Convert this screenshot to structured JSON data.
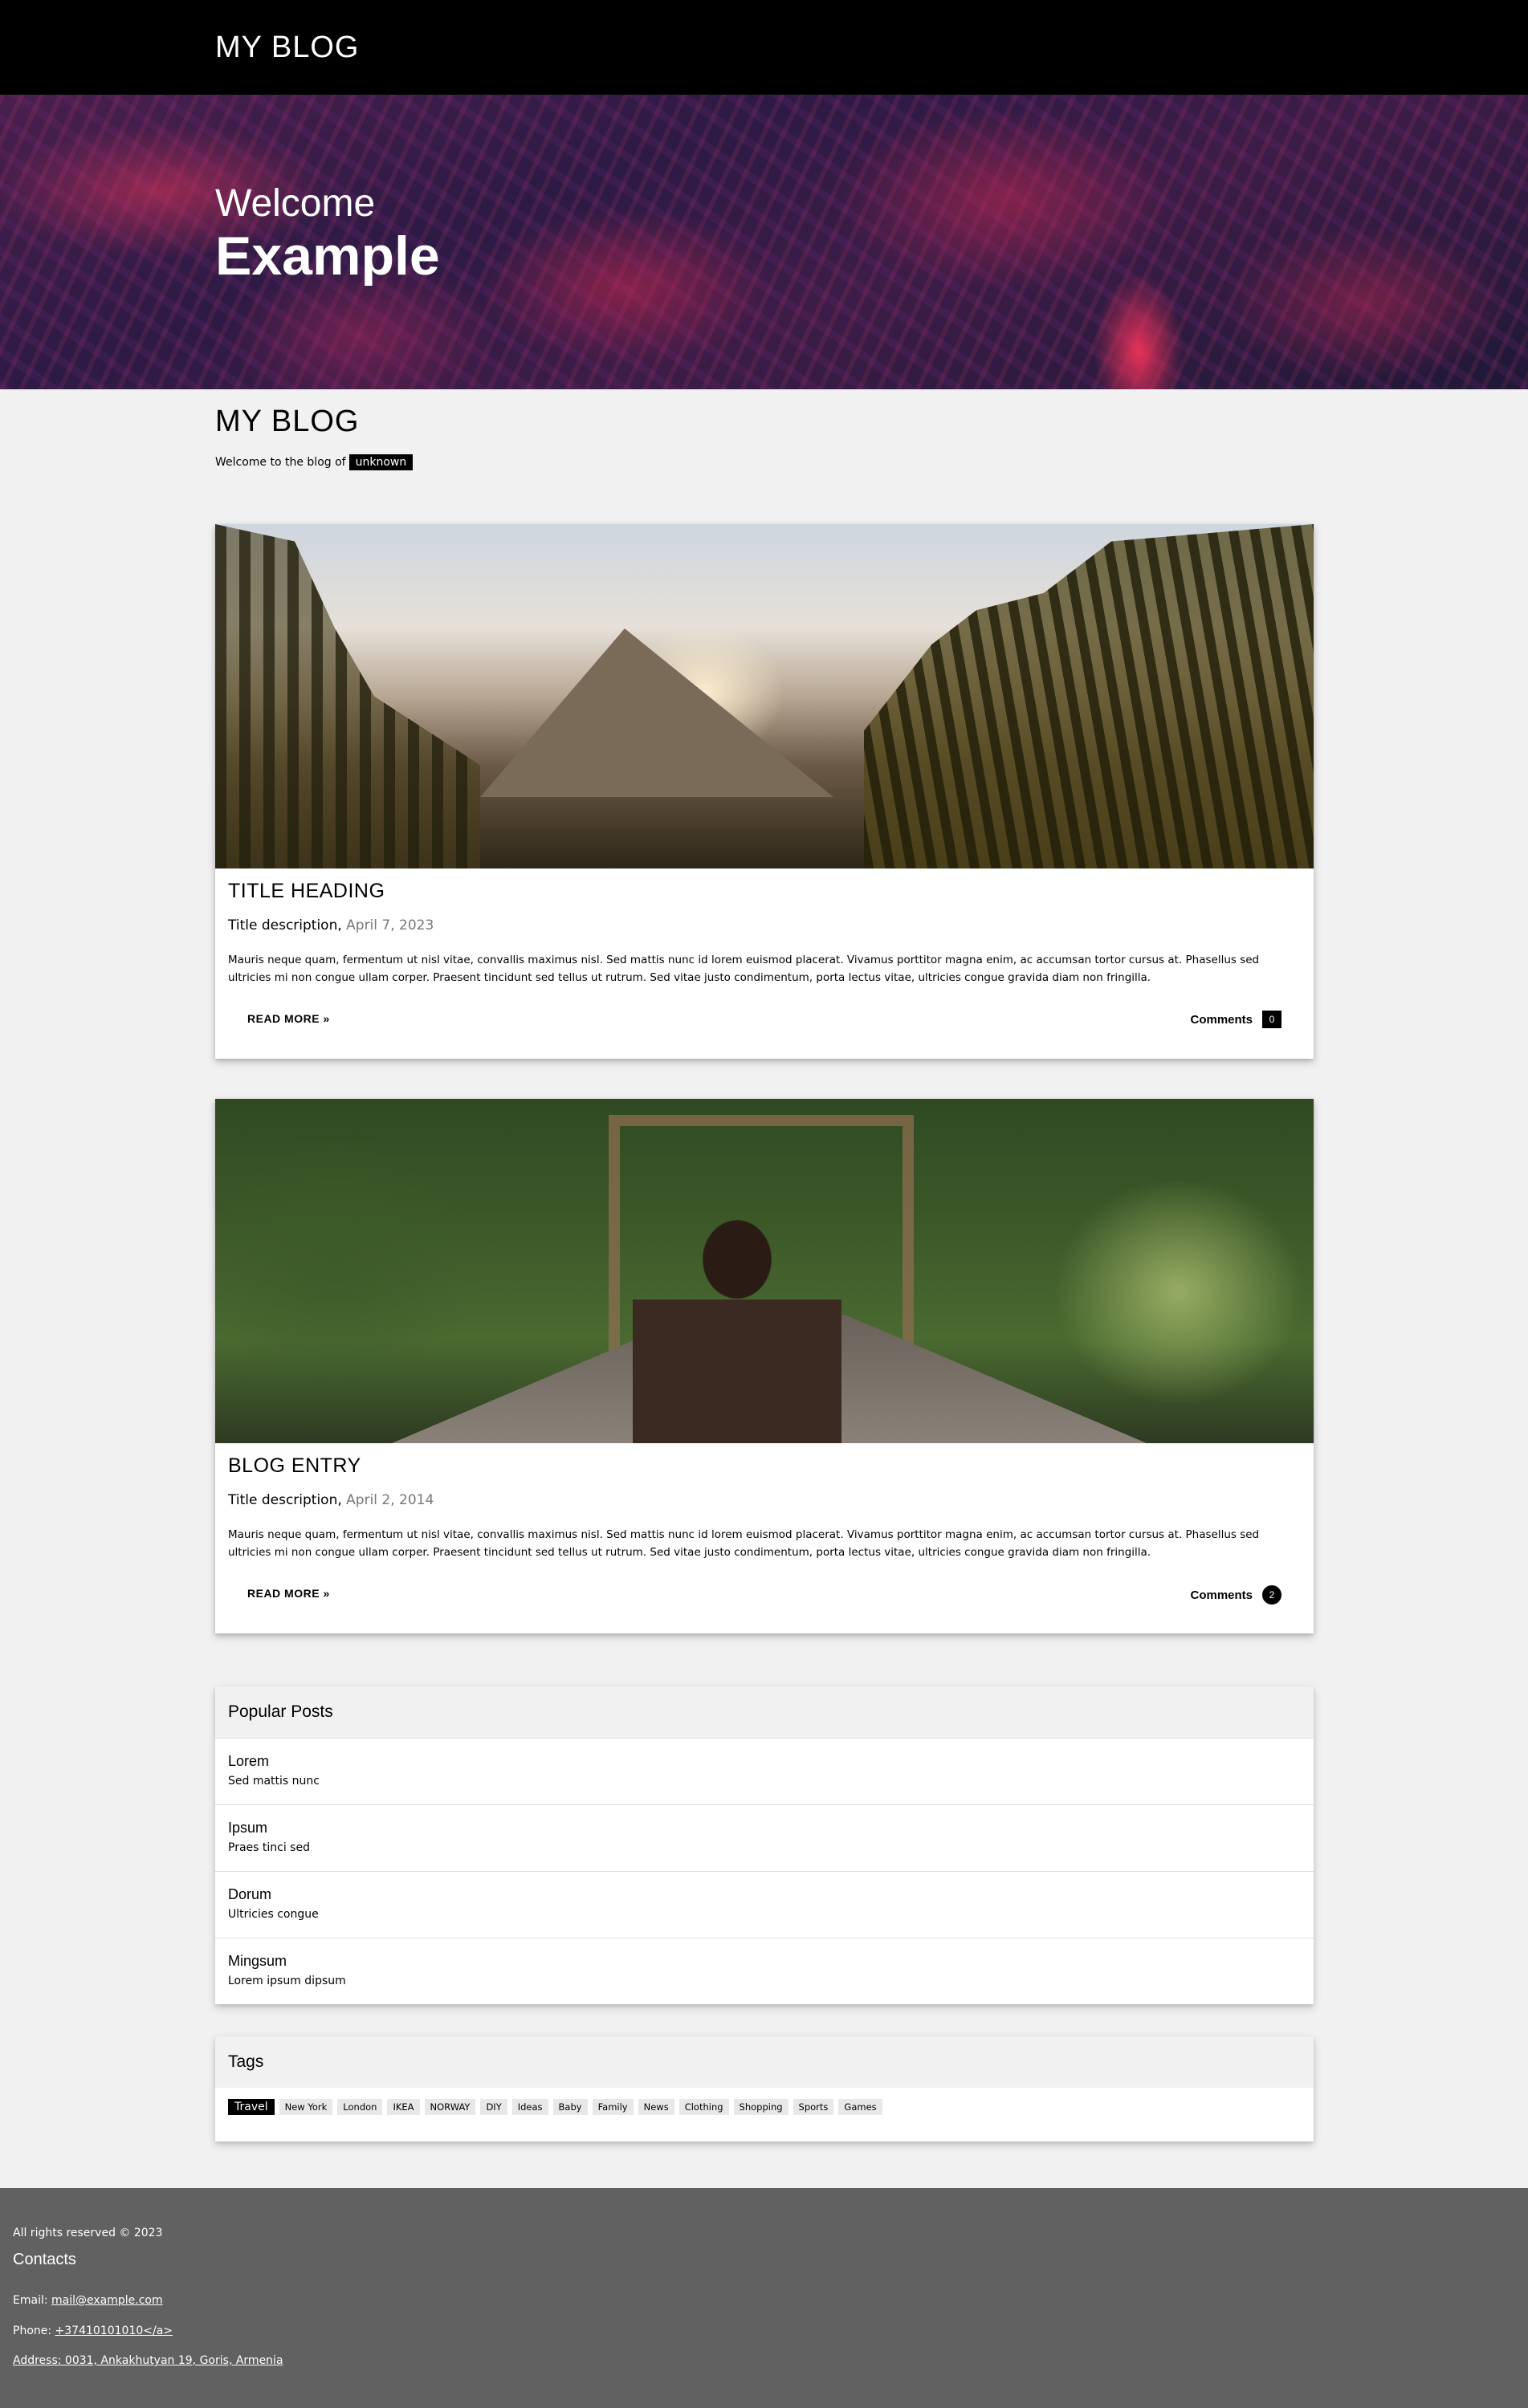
{
  "topbar": {
    "brand": "MY BLOG"
  },
  "hero": {
    "welcome": "Welcome",
    "name": "Example"
  },
  "intro": {
    "title": "MY BLOG",
    "text": "Welcome to the blog of",
    "badge": "unknown"
  },
  "posts": [
    {
      "title": "TITLE HEADING",
      "description": "Title description,",
      "date": "April 7, 2023",
      "body": "Mauris neque quam, fermentum ut nisl vitae, convallis maximus nisl. Sed mattis nunc id lorem euismod placerat. Vivamus porttitor magna enim, ac accumsan tortor cursus at. Phasellus sed ultricies mi non congue ullam corper. Praesent tincidunt sed tellus ut rutrum. Sed vitae justo condimentum, porta lectus vitae, ultricies congue gravida diam non fringilla.",
      "read_more": "READ MORE »",
      "comments_label": "Comments",
      "comments_count": "0"
    },
    {
      "title": "BLOG ENTRY",
      "description": "Title description,",
      "date": "April 2, 2014",
      "body": "Mauris neque quam, fermentum ut nisl vitae, convallis maximus nisl. Sed mattis nunc id lorem euismod placerat. Vivamus porttitor magna enim, ac accumsan tortor cursus at. Phasellus sed ultricies mi non congue ullam corper. Praesent tincidunt sed tellus ut rutrum. Sed vitae justo condimentum, porta lectus vitae, ultricies congue gravida diam non fringilla.",
      "read_more": "READ MORE »",
      "comments_label": "Comments",
      "comments_count": "2"
    }
  ],
  "popular": {
    "heading": "Popular Posts",
    "items": [
      {
        "title": "Lorem",
        "sub": "Sed mattis nunc"
      },
      {
        "title": "Ipsum",
        "sub": "Praes tinci sed"
      },
      {
        "title": "Dorum",
        "sub": "Ultricies congue"
      },
      {
        "title": "Mingsum",
        "sub": "Lorem ipsum dipsum"
      }
    ]
  },
  "tags": {
    "heading": "Tags",
    "items": [
      "Travel",
      "New York",
      "London",
      "IKEA",
      "NORWAY",
      "DIY",
      "Ideas",
      "Baby",
      "Family",
      "News",
      "Clothing",
      "Shopping",
      "Sports",
      "Games"
    ]
  },
  "footer": {
    "rights": "All rights reserved © 2023",
    "contacts": "Contacts",
    "email_label": "Email:",
    "email": "mail@example.com",
    "phone_label": "Phone:",
    "phone": "+37410101010</a>",
    "address": "Address: 0031, Ankakhutyan 19, Goris, Armenia"
  },
  "colors": {
    "topbar": "#000000",
    "footer": "#616161",
    "background": "#f1f1f1"
  }
}
